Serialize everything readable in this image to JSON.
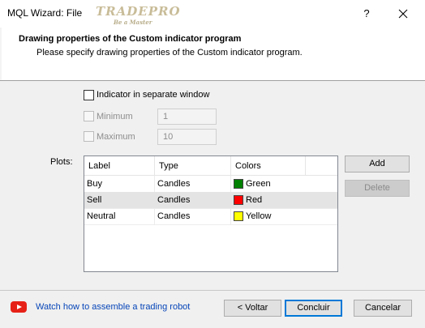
{
  "window": {
    "title": "MQL Wizard: File",
    "help_label": "?",
    "logo_main": "TRADEPRO",
    "logo_sub": "Be a Master"
  },
  "header": {
    "title": "Drawing properties of the Custom indicator program",
    "subtitle": "Please specify drawing properties of the Custom indicator program."
  },
  "options": {
    "separate_window_label": "Indicator in separate window",
    "separate_window_checked": false,
    "minimum_label": "Minimum",
    "minimum_value": "1",
    "maximum_label": "Maximum",
    "maximum_value": "10"
  },
  "plots": {
    "label": "Plots:",
    "columns": [
      "Label",
      "Type",
      "Colors"
    ],
    "rows": [
      {
        "label": "Buy",
        "type": "Candles",
        "color_name": "Green",
        "color_hex": "#008000",
        "selected": false
      },
      {
        "label": "Sell",
        "type": "Candles",
        "color_name": "Red",
        "color_hex": "#ff0000",
        "selected": true
      },
      {
        "label": "Neutral",
        "type": "Candles",
        "color_name": "Yellow",
        "color_hex": "#ffff00",
        "selected": false
      }
    ],
    "add_label": "Add",
    "delete_label": "Delete"
  },
  "footer": {
    "video_icon": "youtube-icon",
    "video_link": "Watch how to assemble a trading robot",
    "back_label": "< Voltar",
    "finish_label": "Concluir",
    "cancel_label": "Cancelar"
  },
  "colors": {
    "accent": "#0078d7",
    "link": "#0645b8",
    "youtube": "#e62117"
  }
}
